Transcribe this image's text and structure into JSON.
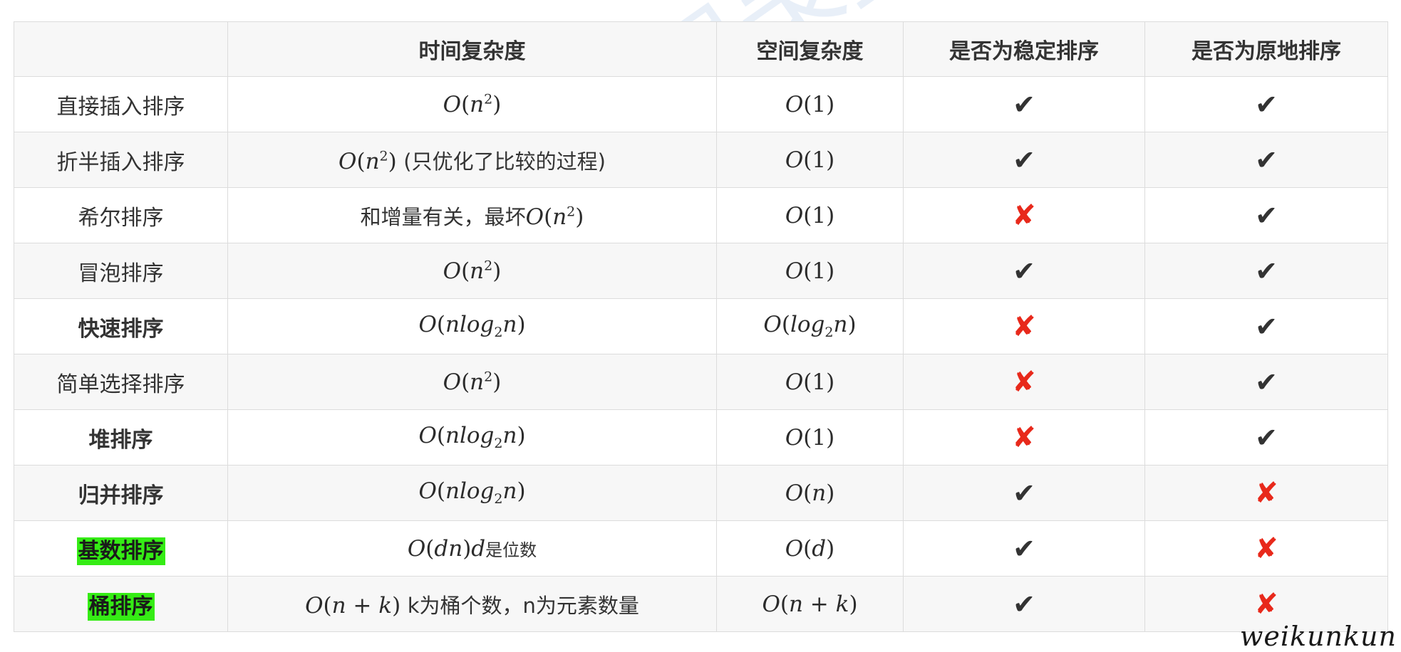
{
  "headers": [
    "",
    "时间复杂度",
    "空间复杂度",
    "是否为稳定排序",
    "是否为原地排序"
  ],
  "rows": [
    {
      "name": "直接插入排序",
      "time_math": "O(n²)",
      "time_note": "",
      "space": "O(1)",
      "stable": "✔",
      "inplace": "✔"
    },
    {
      "name": "折半插入排序",
      "time_math": "O(n²)",
      "time_note": "(只优化了比较的过程)",
      "space": "O(1)",
      "stable": "✔",
      "inplace": "✔"
    },
    {
      "name": "希尔排序",
      "time_prefix": "和增量有关，最坏",
      "time_math": "O(n²)",
      "space": "O(1)",
      "stable": "✘",
      "inplace": "✔"
    },
    {
      "name": "冒泡排序",
      "time_math": "O(n²)",
      "space": "O(1)",
      "stable": "✔",
      "inplace": "✔"
    },
    {
      "name": "快速排序",
      "time_math": "O(nlog₂n)",
      "space": "O(log₂n)",
      "stable": "✘",
      "inplace": "✔"
    },
    {
      "name": "简单选择排序",
      "time_math": "O(n²)",
      "space": "O(1)",
      "stable": "✘",
      "inplace": "✔"
    },
    {
      "name": "堆排序",
      "time_math": "O(nlog₂n)",
      "space": "O(1)",
      "stable": "✘",
      "inplace": "✔"
    },
    {
      "name": "归并排序",
      "time_math": "O(nlog₂n)",
      "space": "O(n)",
      "stable": "✔",
      "inplace": "✘"
    },
    {
      "name": "基数排序",
      "time_math": "O(dn)d",
      "time_note": "是位数",
      "space": "O(d)",
      "stable": "✔",
      "inplace": "✘"
    },
    {
      "name": "桶排序",
      "time_math": "O(n + k)",
      "time_note": "k为桶个数，n为元素数量",
      "space": "O(n + k)",
      "stable": "✔",
      "inplace": "✘"
    }
  ],
  "watermark": "「代码随想录」知识星球",
  "signature": "weikunkun",
  "colors": {
    "cross": "#e8291b",
    "highlight": "#35ec15",
    "border": "#dcdcdc",
    "stripe": "#f7f7f7"
  }
}
